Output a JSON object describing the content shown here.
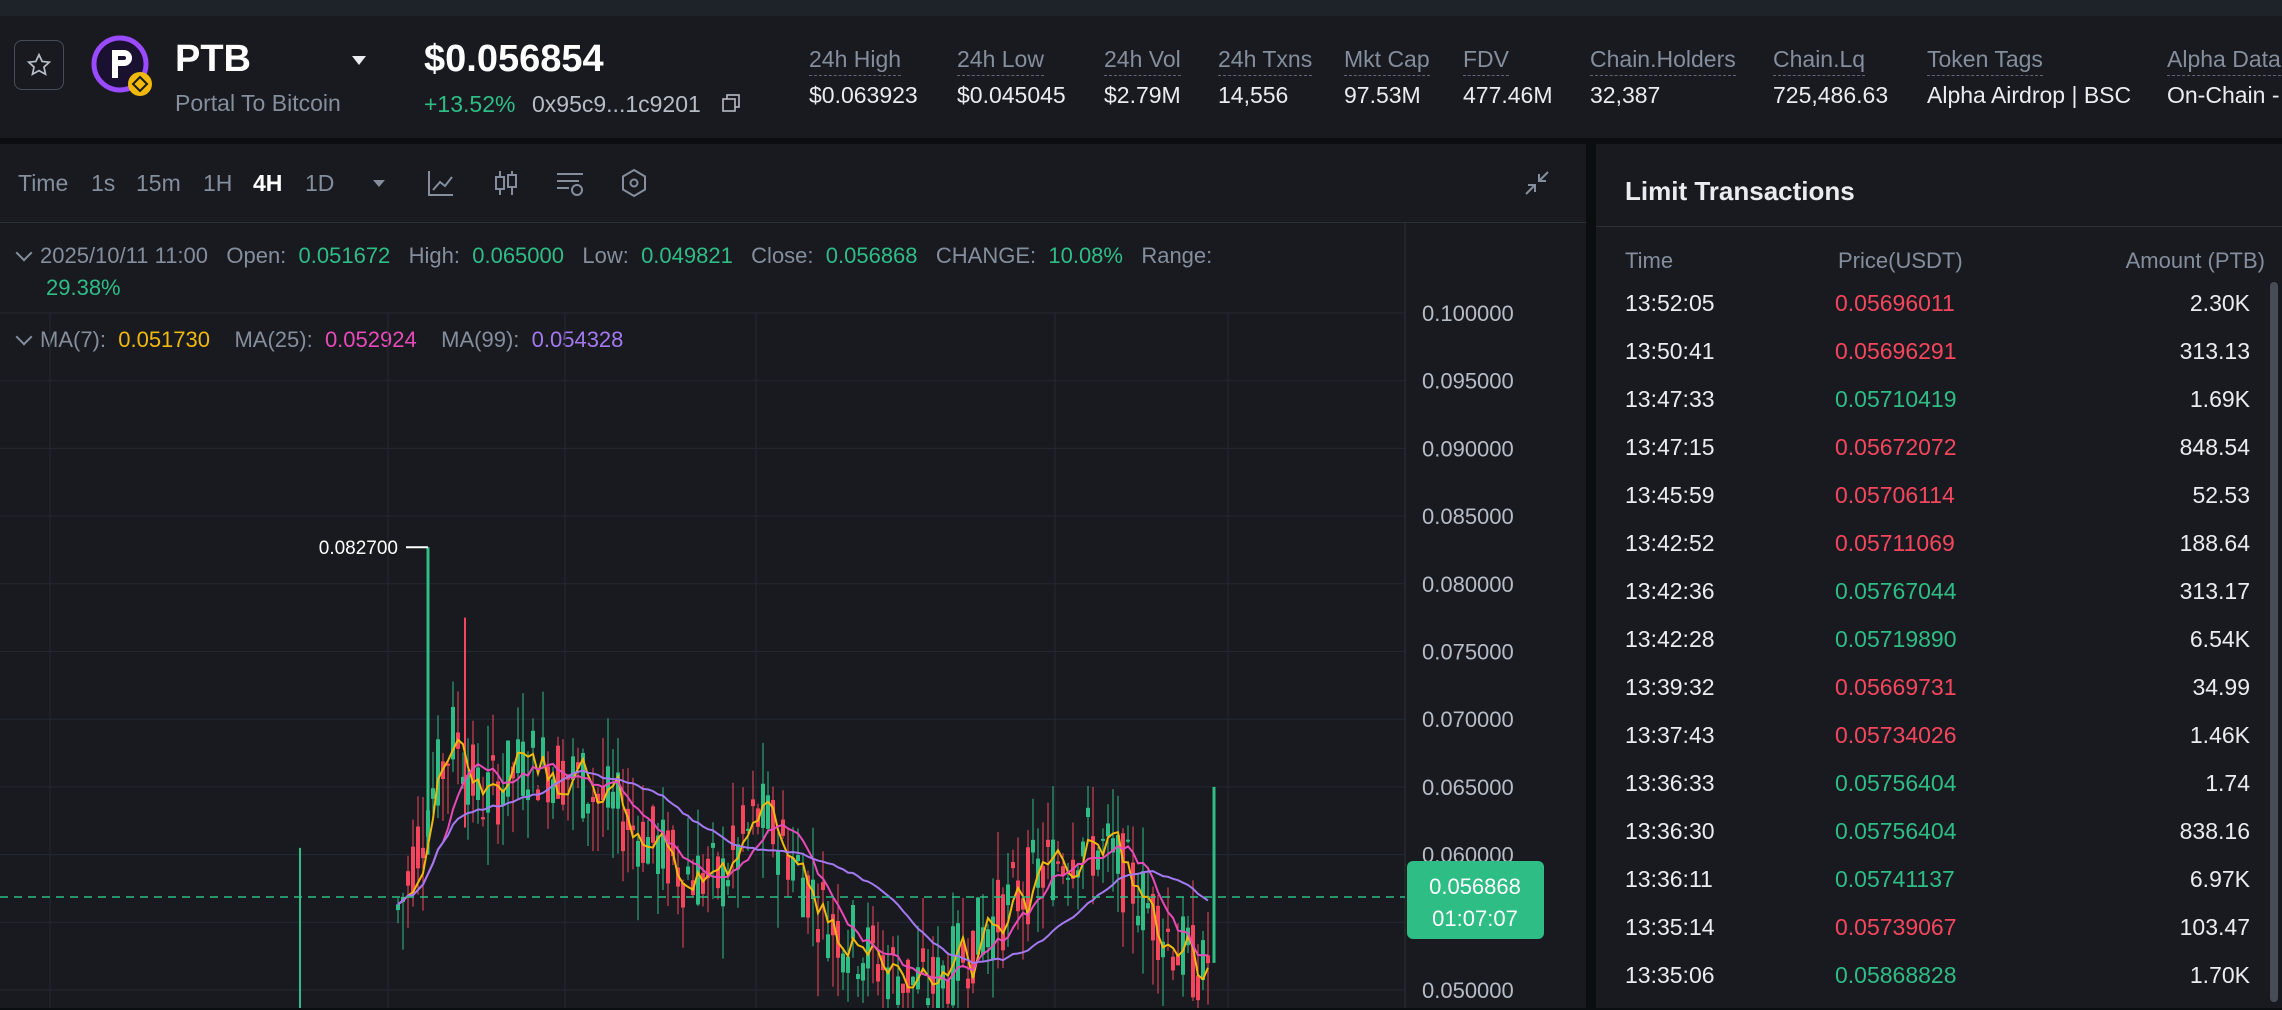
{
  "token": {
    "symbol": "PTB",
    "full_name": "Portal To Bitcoin",
    "price": "$0.056854",
    "change": "+13.52%",
    "address": "0x95c9...1c9201"
  },
  "stats": [
    {
      "label": "24h High",
      "value": "$0.063923"
    },
    {
      "label": "24h Low",
      "value": "$0.045045"
    },
    {
      "label": "24h Vol",
      "value": "$2.79M"
    },
    {
      "label": "24h Txns",
      "value": "14,556"
    },
    {
      "label": "Mkt Cap",
      "value": "97.53M"
    },
    {
      "label": "FDV",
      "value": "477.46M"
    },
    {
      "label": "Chain.Holders",
      "value": "32,387"
    },
    {
      "label": "Chain.Lq",
      "value": "725,486.63"
    },
    {
      "label": "Token Tags",
      "value": "Alpha Airdrop | BSC"
    },
    {
      "label": "Alpha Data",
      "value": "On-Chain -"
    }
  ],
  "toolbar": {
    "intervals": [
      "Time",
      "1s",
      "15m",
      "1H",
      "4H",
      "1D"
    ],
    "active": "4H"
  },
  "ohlc": {
    "date": "2025/10/11 11:00",
    "open_label": "Open:",
    "open": "0.051672",
    "high_label": "High:",
    "high": "0.065000",
    "low_label": "Low:",
    "low": "0.049821",
    "close_label": "Close:",
    "close": "0.056868",
    "change_label": "CHANGE:",
    "change": "10.08%",
    "range_label": "Range:",
    "range": "29.38%"
  },
  "ma": {
    "ma7_label": "MA(7):",
    "ma7": "0.051730",
    "ma25_label": "MA(25):",
    "ma25": "0.052924",
    "ma99_label": "MA(99):",
    "ma99": "0.054328"
  },
  "chart_data": {
    "type": "candlestick",
    "y_ticks": [
      "0.100000",
      "0.095000",
      "0.090000",
      "0.085000",
      "0.080000",
      "0.075000",
      "0.070000",
      "0.065000",
      "0.060000",
      "0.050000"
    ],
    "ylim": [
      0.0485,
      0.1015
    ],
    "peak_label": "0.082700",
    "peak_value": 0.0827,
    "last_price": "0.056868",
    "last_price_value": 0.056868,
    "countdown": "01:07:07",
    "colors": {
      "up": "#2ebd85",
      "down": "#f6465d",
      "ma7": "#f0b90b",
      "ma25": "#e84ab7",
      "ma99": "#a478f0"
    }
  },
  "transactions": {
    "title": "Limit Transactions",
    "headers": [
      "Time",
      "Price(USDT)",
      "Amount (PTB)"
    ],
    "rows": [
      {
        "time": "13:52:05",
        "price": "0.05696011",
        "amount": "2.30K",
        "side": "down"
      },
      {
        "time": "13:50:41",
        "price": "0.05696291",
        "amount": "313.13",
        "side": "down"
      },
      {
        "time": "13:47:33",
        "price": "0.05710419",
        "amount": "1.69K",
        "side": "up"
      },
      {
        "time": "13:47:15",
        "price": "0.05672072",
        "amount": "848.54",
        "side": "down"
      },
      {
        "time": "13:45:59",
        "price": "0.05706114",
        "amount": "52.53",
        "side": "down"
      },
      {
        "time": "13:42:52",
        "price": "0.05711069",
        "amount": "188.64",
        "side": "down"
      },
      {
        "time": "13:42:36",
        "price": "0.05767044",
        "amount": "313.17",
        "side": "up"
      },
      {
        "time": "13:42:28",
        "price": "0.05719890",
        "amount": "6.54K",
        "side": "up"
      },
      {
        "time": "13:39:32",
        "price": "0.05669731",
        "amount": "34.99",
        "side": "down"
      },
      {
        "time": "13:37:43",
        "price": "0.05734026",
        "amount": "1.46K",
        "side": "down"
      },
      {
        "time": "13:36:33",
        "price": "0.05756404",
        "amount": "1.74",
        "side": "up"
      },
      {
        "time": "13:36:30",
        "price": "0.05756404",
        "amount": "838.16",
        "side": "up"
      },
      {
        "time": "13:36:11",
        "price": "0.05741137",
        "amount": "6.97K",
        "side": "up"
      },
      {
        "time": "13:35:14",
        "price": "0.05739067",
        "amount": "103.47",
        "side": "down"
      },
      {
        "time": "13:35:06",
        "price": "0.05868828",
        "amount": "1.70K",
        "side": "up"
      }
    ]
  },
  "icons": {
    "favorite": "star-icon",
    "copy": "copy-icon",
    "chart_line": "line-chart-icon",
    "candles": "candlestick-icon",
    "indicators": "indicator-icon",
    "settings": "hexagon-settings-icon",
    "collapse": "collapse-icon",
    "chevron": "chevron-down-icon"
  }
}
